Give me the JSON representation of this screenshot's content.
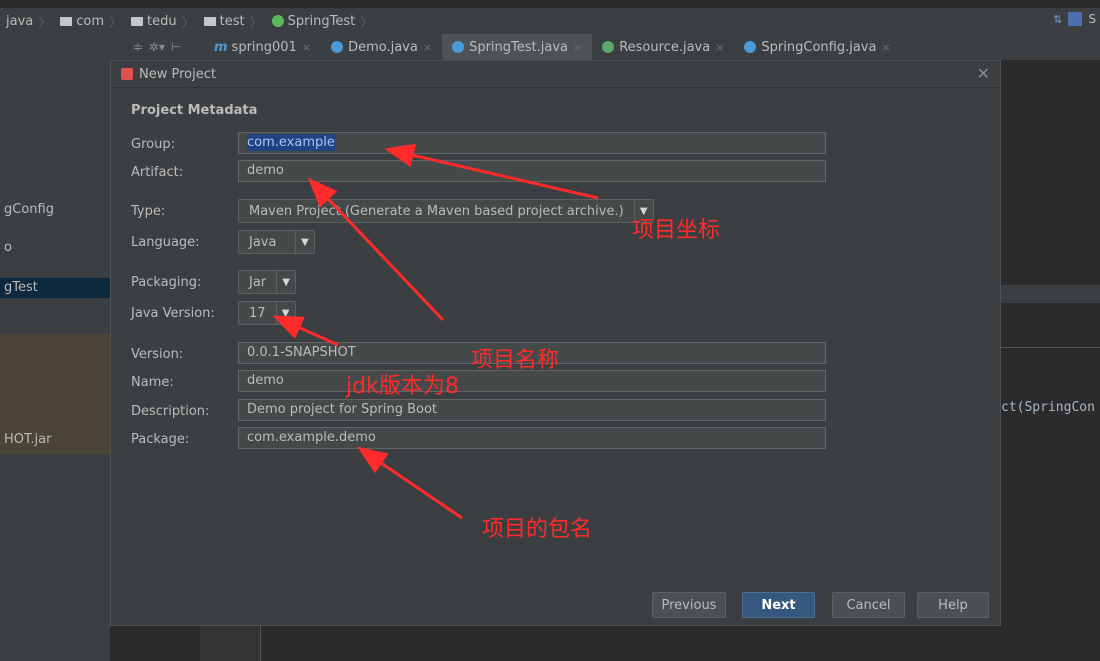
{
  "breadcrumb": [
    {
      "label": "java",
      "icon": "none"
    },
    {
      "label": "com",
      "icon": "folder-icon"
    },
    {
      "label": "tedu",
      "icon": "folder-icon"
    },
    {
      "label": "test",
      "icon": "folder-icon"
    },
    {
      "label": "SpringTest",
      "icon": "spring-icon"
    }
  ],
  "breadcrumb_right": {
    "label": "S"
  },
  "editor_tabs": [
    {
      "label": "spring001",
      "icon": "maven-icon",
      "active": false
    },
    {
      "label": "Demo.java",
      "icon": "class-icon",
      "active": false
    },
    {
      "label": "SpringTest.java",
      "icon": "class-icon",
      "active": true
    },
    {
      "label": "Resource.java",
      "icon": "interface-icon",
      "active": false
    },
    {
      "label": "SpringConfig.java",
      "icon": "class-icon",
      "active": false
    }
  ],
  "left_panel": {
    "items": [
      "gConfig",
      "o",
      "gTest",
      "HOT.jar"
    ]
  },
  "background_code": "ct(SpringCon",
  "dialog": {
    "title": "New Project",
    "section_title": "Project Metadata",
    "fields": {
      "group": {
        "label": "Group:",
        "value": "com.example"
      },
      "artifact": {
        "label": "Artifact:",
        "value": "demo"
      },
      "type": {
        "label": "Type:",
        "value": "Maven Project (Generate a Maven based project archive.)"
      },
      "language": {
        "label": "Language:",
        "value": "Java"
      },
      "packaging": {
        "label": "Packaging:",
        "value": "Jar"
      },
      "java_version": {
        "label": "Java Version:",
        "value": "17"
      },
      "version": {
        "label": "Version:",
        "value": "0.0.1-SNAPSHOT"
      },
      "name": {
        "label": "Name:",
        "value": "demo"
      },
      "description": {
        "label": "Description:",
        "value": "Demo project for Spring Boot"
      },
      "package": {
        "label": "Package:",
        "value": "com.example.demo"
      }
    },
    "buttons": {
      "previous": "Previous",
      "next": "Next",
      "cancel": "Cancel",
      "help": "Help"
    }
  },
  "annotations": {
    "coords": "项目坐标",
    "project_name": "项目名称",
    "jdk": "jdk版本为8",
    "package_name": "项目的包名"
  },
  "colors": {
    "annotation": "#ff2a2a",
    "primary_button": "#365880",
    "selection": "#214283"
  }
}
